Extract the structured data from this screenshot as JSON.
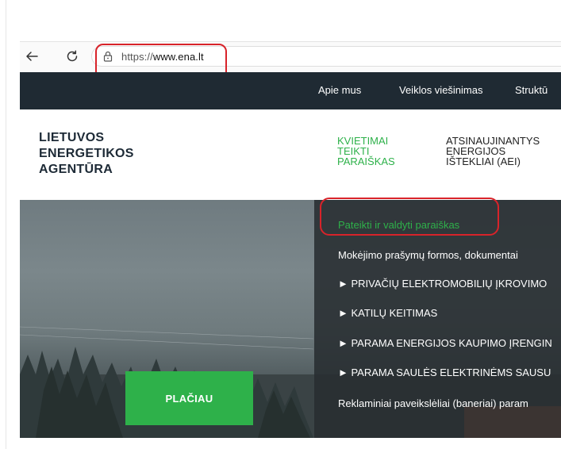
{
  "browser": {
    "url_prefix": "https://",
    "url_host": "www.ena.lt"
  },
  "topnav": {
    "items": [
      "Apie mus",
      "Veiklos viešinimas",
      "Struktū"
    ]
  },
  "logo": {
    "lines": [
      "LIETUVOS",
      "ENERGETIKOS",
      "AGENTŪRA"
    ]
  },
  "menu": {
    "item1_lines": [
      "KVIETIMAI",
      "TEIKTI",
      "PARAIŠKAS"
    ],
    "item2_lines": [
      "ATSINAUJINANTYS",
      "ENERGIJOS",
      "IŠTEKLIAI (AEI)"
    ]
  },
  "hero": {
    "button_label": "PLAČIAU"
  },
  "dropdown": {
    "items": [
      "Pateikti ir valdyti paraiškas",
      "Mokėjimo prašymų formos, dokumentai",
      "► PRIVAČIŲ ELEKTROMOBILIŲ ĮKROVIMO",
      "► KATILŲ KEITIMAS",
      "► PARAMA ENERGIJOS KAUPIMO ĮRENGIN",
      "► PARAMA SAULĖS ELEKTRINĖMS SAUSU",
      "Reklaminiai paveikslėliai (baneriai) param"
    ]
  },
  "colors": {
    "accent_green": "#2eb14a",
    "nav_dark": "#1f2a33",
    "highlight_red": "#d8232a"
  }
}
